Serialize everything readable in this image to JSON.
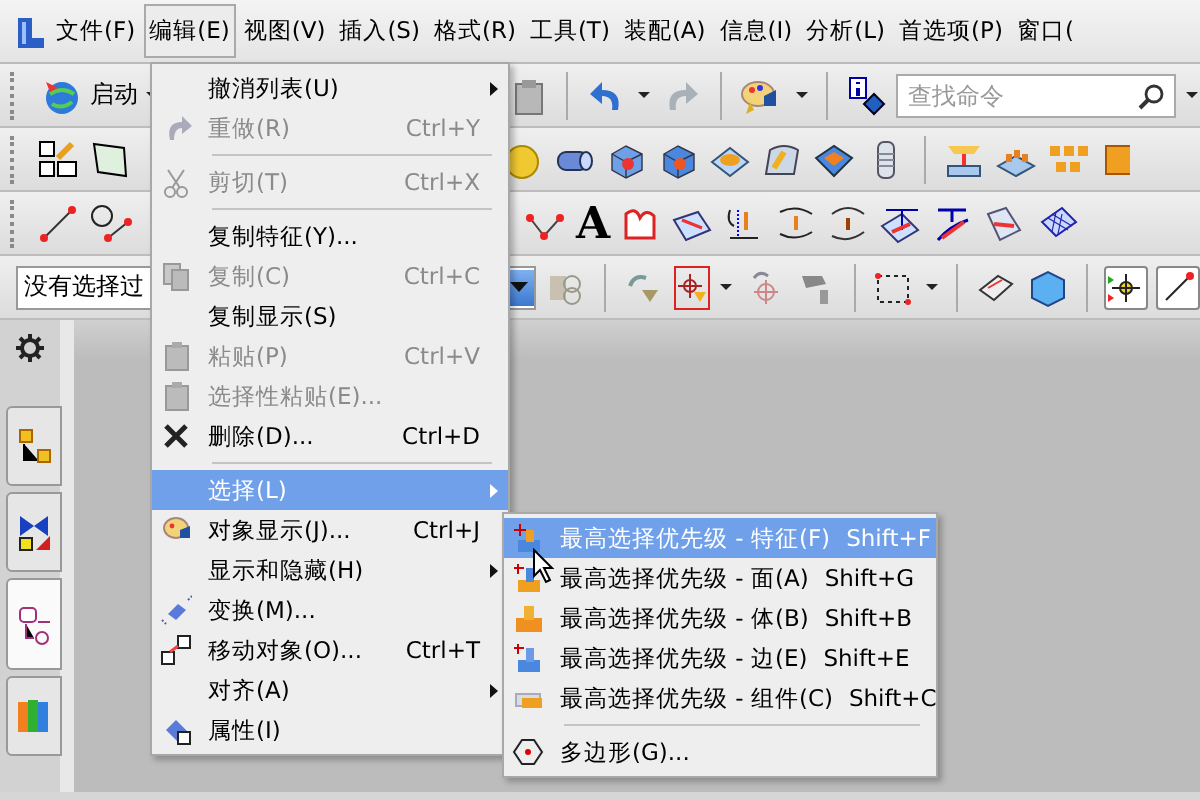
{
  "menubar": [
    {
      "label": "文件(F)",
      "selected": false
    },
    {
      "label": "编辑(E)",
      "selected": true
    },
    {
      "label": "视图(V)",
      "selected": false
    },
    {
      "label": "插入(S)",
      "selected": false
    },
    {
      "label": "格式(R)",
      "selected": false
    },
    {
      "label": "工具(T)",
      "selected": false
    },
    {
      "label": "装配(A)",
      "selected": false
    },
    {
      "label": "信息(I)",
      "selected": false
    },
    {
      "label": "分析(L)",
      "selected": false
    },
    {
      "label": "首选项(P)",
      "selected": false
    },
    {
      "label": "窗口(",
      "selected": false
    }
  ],
  "toolbar": {
    "start_button": "启动",
    "search": {
      "placeholder": "查找命令"
    },
    "text_tool": "A",
    "filter": {
      "value": "没有选择过"
    }
  },
  "edit_menu": [
    {
      "kind": "item",
      "label": "撤消列表(U)",
      "submenu": true,
      "disabled": false,
      "selected": false
    },
    {
      "kind": "item",
      "label": "重做(R)",
      "shortcut": "Ctrl+Y",
      "disabled": true,
      "selected": false
    },
    {
      "kind": "separator"
    },
    {
      "kind": "item",
      "label": "剪切(T)",
      "shortcut": "Ctrl+X",
      "disabled": true,
      "selected": false
    },
    {
      "kind": "separator"
    },
    {
      "kind": "item",
      "label": "复制特征(Y)...",
      "disabled": false,
      "selected": false
    },
    {
      "kind": "item",
      "label": "复制(C)",
      "shortcut": "Ctrl+C",
      "disabled": true,
      "selected": false
    },
    {
      "kind": "item",
      "label": "复制显示(S)",
      "disabled": false,
      "selected": false
    },
    {
      "kind": "item",
      "label": "粘贴(P)",
      "shortcut": "Ctrl+V",
      "disabled": true,
      "selected": false
    },
    {
      "kind": "item",
      "label": "选择性粘贴(E)...",
      "disabled": true,
      "selected": false
    },
    {
      "kind": "item",
      "label": "删除(D)...",
      "shortcut": "Ctrl+D",
      "disabled": false,
      "selected": false
    },
    {
      "kind": "separator"
    },
    {
      "kind": "item",
      "label": "选择(L)",
      "submenu": true,
      "disabled": false,
      "selected": true
    },
    {
      "kind": "item",
      "label": "对象显示(J)...",
      "shortcut": "Ctrl+J",
      "disabled": false,
      "selected": false
    },
    {
      "kind": "item",
      "label": "显示和隐藏(H)",
      "submenu": true,
      "disabled": false,
      "selected": false
    },
    {
      "kind": "item",
      "label": "变换(M)...",
      "disabled": false,
      "selected": false
    },
    {
      "kind": "item",
      "label": "移动对象(O)...",
      "shortcut": "Ctrl+T",
      "disabled": false,
      "selected": false
    },
    {
      "kind": "item",
      "label": "对齐(A)",
      "submenu": true,
      "disabled": false,
      "selected": false
    },
    {
      "kind": "item",
      "label": "属性(I)",
      "disabled": false,
      "selected": false
    }
  ],
  "select_submenu": [
    {
      "kind": "item",
      "label": "最高选择优先级 - 特征(F)",
      "shortcut": "Shift+F",
      "disabled": false,
      "selected": true
    },
    {
      "kind": "item",
      "label": "最高选择优先级 - 面(A)",
      "shortcut": "Shift+G",
      "disabled": false,
      "selected": false
    },
    {
      "kind": "item",
      "label": "最高选择优先级 - 体(B)",
      "shortcut": "Shift+B",
      "disabled": false,
      "selected": false
    },
    {
      "kind": "item",
      "label": "最高选择优先级 - 边(E)",
      "shortcut": "Shift+E",
      "disabled": false,
      "selected": false
    },
    {
      "kind": "item",
      "label": "最高选择优先级 - 组件(C)",
      "shortcut": "Shift+C",
      "disabled": false,
      "selected": false
    },
    {
      "kind": "separator"
    },
    {
      "kind": "item",
      "label": "多边形(G)...",
      "disabled": false,
      "selected": false
    }
  ]
}
